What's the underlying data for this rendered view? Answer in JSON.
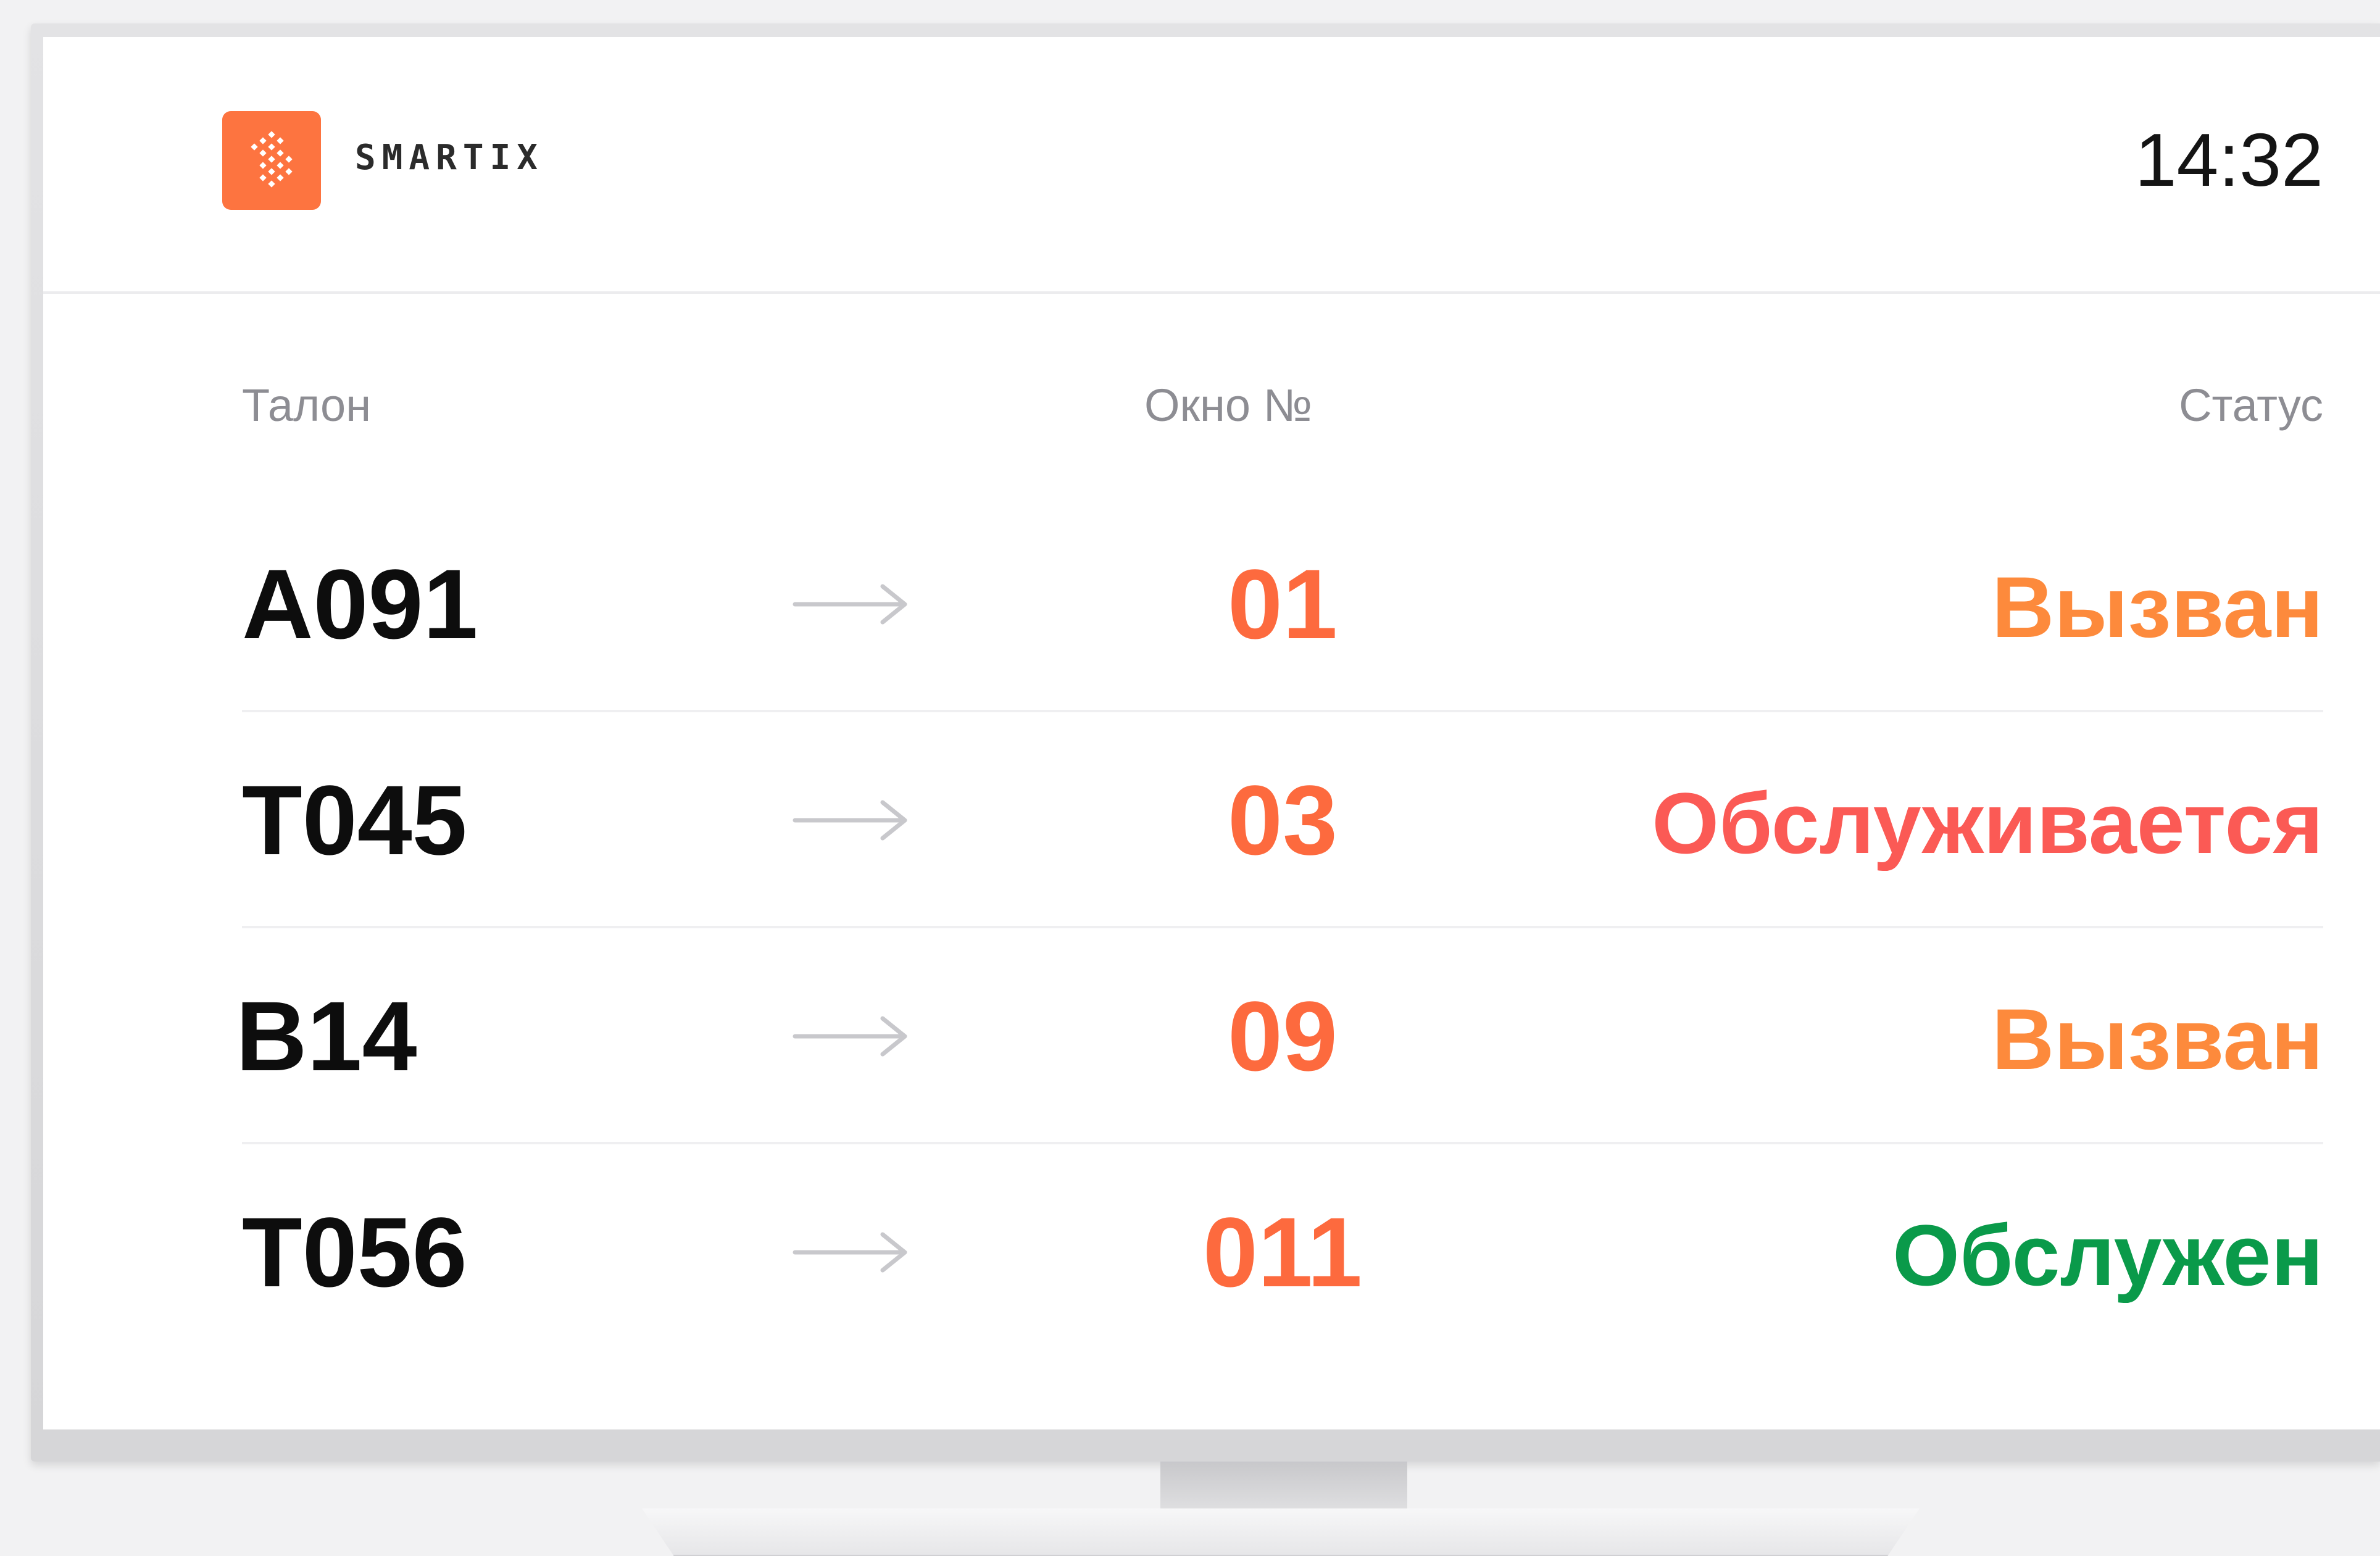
{
  "header": {
    "brand_name": "SMARTIX",
    "clock": "14:32"
  },
  "table": {
    "columns": {
      "ticket": "Талон",
      "window": "Окно №",
      "status": "Статус"
    },
    "rows": [
      {
        "ticket": "A091",
        "window": "01",
        "status": "Вызван",
        "status_color": "#fd8a3c"
      },
      {
        "ticket": "T045",
        "window": "03",
        "status": "Обслуживается",
        "status_color": "#fb5a55"
      },
      {
        "ticket": "B14",
        "window": "09",
        "status": "Вызван",
        "status_color": "#fd8a3c"
      },
      {
        "ticket": "T056",
        "window": "011",
        "status": "Обслужен",
        "status_color": "#0a9a4a"
      }
    ]
  },
  "colors": {
    "brand": "#fd7440",
    "window_number": "#fd6a3e",
    "arrow": "#c8c8cc",
    "ticket_text": "#0d0d0d"
  },
  "icons": {
    "logo": "smartix-logo-icon",
    "row_arrow": "arrow-right-icon"
  }
}
